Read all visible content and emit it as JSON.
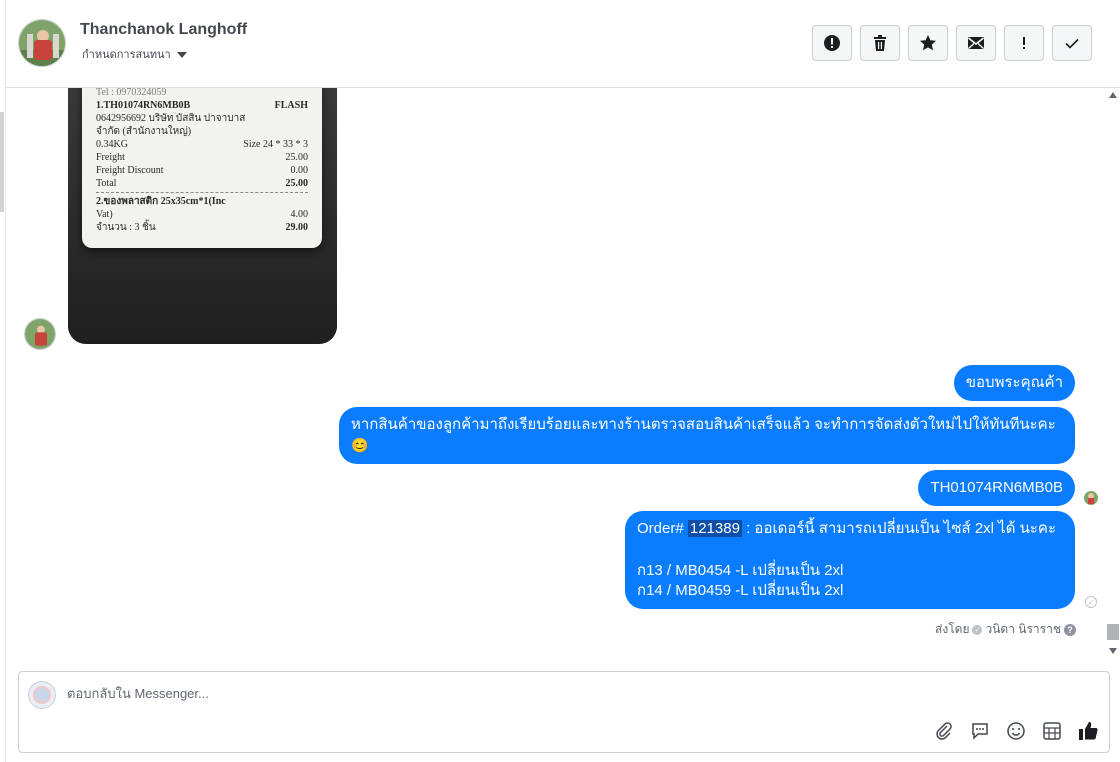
{
  "header": {
    "contact_name": "Thanchanok Langhoff",
    "conversation_status": "กำหนดการสนทนา",
    "toolbar": [
      {
        "name": "mark-spam-button",
        "icon": "alert-circle-icon"
      },
      {
        "name": "delete-button",
        "icon": "trash-icon"
      },
      {
        "name": "star-button",
        "icon": "star-icon"
      },
      {
        "name": "mark-unread-button",
        "icon": "envelope-icon"
      },
      {
        "name": "follow-up-button",
        "icon": "exclamation-icon"
      },
      {
        "name": "mark-done-button",
        "icon": "checkmark-icon"
      }
    ]
  },
  "receipt_image": {
    "line_tel": "Tel : 0970324059",
    "tracking": "1.TH01074RN6MB0B",
    "carrier": "FLASH",
    "address_line1": "0642956692 บริษัท บัสสิน ปาจาบาส",
    "address_line2": "จำกัด (สำนักงานใหญ่)",
    "weight": "0.34KG",
    "size": "Size 24 * 33 * 3",
    "freight_label": "Freight",
    "freight_value": "25.00",
    "discount_label": "Freight Discount",
    "discount_value": "0.00",
    "total_label": "Total",
    "total_value": "25.00",
    "item_line": "2.ของพลาสติก 25x35cm*1(Inc",
    "item_vat": "Vat)",
    "item_value": "4.00",
    "qty_line": "จำนวน : 3 ชิ้น",
    "qty_value": "29.00"
  },
  "messages": {
    "thanks": "ขอบพระคุณค้า",
    "inspect_line1": "หากสินค้าของลูกค้ามาถึงเรียบร้อยและทางร้านตรวจสอบสินค้าเสร็จแล้ว จะทำการจัดส่งตัวใหม่ไปให้ทันทีนะคะ",
    "inspect_emoji": "😊",
    "tracking": "TH01074RN6MB0B",
    "order_prefix": "Order#",
    "order_number": "121389",
    "order_suffix": ": ออเดอร์นี้ สามารถเปลี่ยนเป็น ไซส์ 2xl ได้ นะคะ",
    "order_line2": "ก13 / MB0454 -L เปลี่ยนเป็น 2xl",
    "order_line3": "ก14 / MB0459 -L เปลี่ยนเป็น 2xl"
  },
  "sent_by": {
    "label": "ส่งโดย",
    "agent": "วนิดา นิราราช",
    "help": "?"
  },
  "composer": {
    "placeholder": "ตอบกลับใน Messenger...",
    "tools": [
      "attachment-icon",
      "saved-reply-icon",
      "emoji-icon",
      "calendar-grid-icon",
      "thumbs-up-icon"
    ]
  },
  "colors": {
    "bubble": "#0a7cff",
    "highlight": "#0c4fa8",
    "border": "#ccd0d5"
  }
}
